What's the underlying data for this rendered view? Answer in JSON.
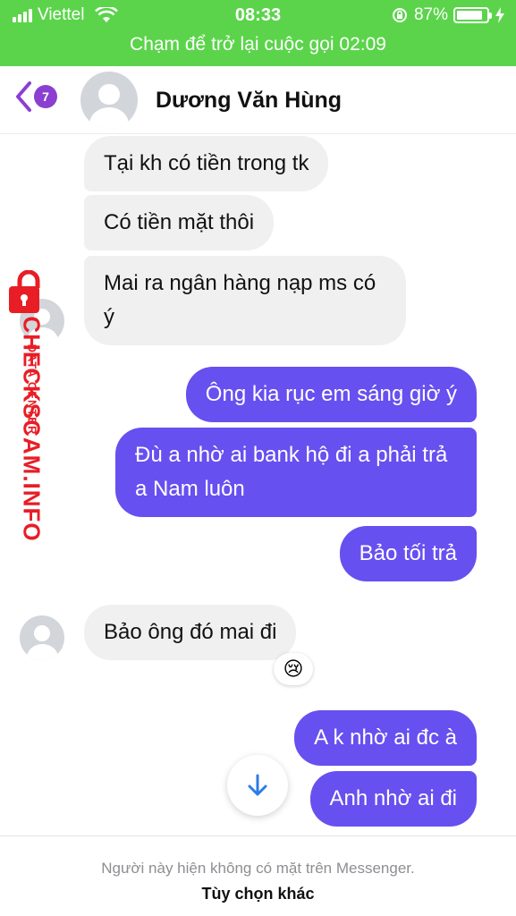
{
  "status_bar": {
    "carrier": "Viettel",
    "time": "08:33",
    "battery_percent_text": "87%",
    "battery_level": 0.87,
    "call_banner": "Chạm để trở lại cuộc gọi 02:09",
    "bg_color": "#5bd44b"
  },
  "header": {
    "unread_count": "7",
    "contact_name": "Dương Văn Hùng",
    "back_icon": "chevron-left-icon",
    "accent": "#8a3fd1"
  },
  "messages": [
    {
      "direction": "in",
      "text": "Tại kh có tiền trong tk"
    },
    {
      "direction": "in",
      "text": "Có tiền mặt thôi"
    },
    {
      "direction": "in",
      "text": "Mai ra ngân hàng nạp ms có ý"
    },
    {
      "direction": "out",
      "text": "Ông kia rục em sáng giờ ý"
    },
    {
      "direction": "out",
      "text": "Đù a nhờ ai bank hộ đi a phải trả a Nam luôn"
    },
    {
      "direction": "out",
      "text": "Bảo tối trả"
    },
    {
      "direction": "in",
      "text": "Bảo ông đó mai đi",
      "reaction": "😢"
    },
    {
      "direction": "out",
      "text": "A k nhờ ai đc à"
    },
    {
      "direction": "out",
      "text": "Anh nhờ ai đi"
    }
  ],
  "colors": {
    "outgoing_bubble": "#6650f0",
    "incoming_bubble": "#f0f0f0"
  },
  "watermark": {
    "main": "CHECKSCAM.INFO",
    "sub": "DATA CENTER",
    "color": "#e81d26"
  },
  "footer": {
    "status": "Người này hiện không có mặt trên Messenger.",
    "link": "Tùy chọn khác"
  },
  "scroll_button_icon": "arrow-down-icon"
}
